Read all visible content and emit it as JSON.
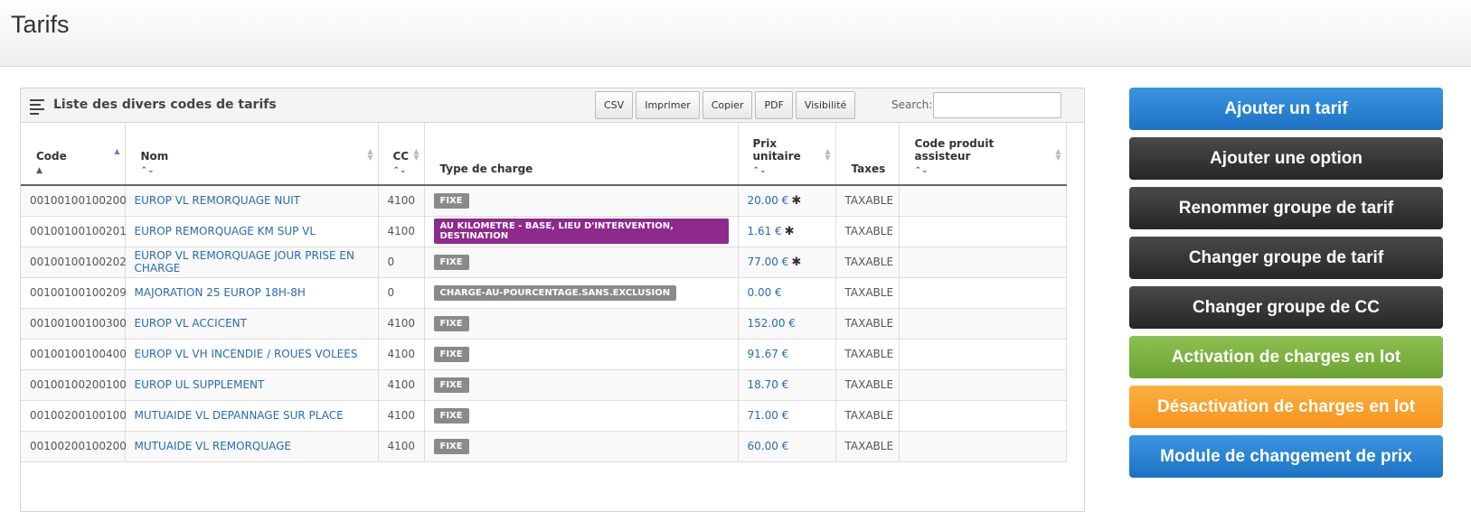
{
  "page": {
    "title": "Tarifs"
  },
  "panel": {
    "title": "Liste des divers codes de tarifs",
    "tools": [
      "CSV",
      "Imprimer",
      "Copier",
      "PDF",
      "Visibilité"
    ],
    "search_label": "Search:",
    "search_value": ""
  },
  "columns": {
    "code": "Code",
    "nom": "Nom",
    "cc": "CC",
    "type": "Type de charge",
    "prix": "Prix unitaire",
    "taxes": "Taxes",
    "assisteur": "Code produit assisteur"
  },
  "rows": [
    {
      "code": "00100100100200",
      "nom": "EUROP VL REMORQUAGE NUIT",
      "cc": "4100",
      "type": "FIXE",
      "type_color": "#8a8a8a",
      "prix": "20.00 €",
      "star": "✱",
      "taxes": "TAXABLE",
      "assisteur": ""
    },
    {
      "code": "00100100100201",
      "nom": "EUROP REMORQUAGE KM SUP VL",
      "cc": "4100",
      "type": "AU KILOMETRE - BASE, LIEU D'INTERVENTION, DESTINATION",
      "type_color": "#8e2a8c",
      "prix": "1.61 €",
      "star": "✱",
      "taxes": "TAXABLE",
      "assisteur": ""
    },
    {
      "code": "00100100100202",
      "nom": "EUROP VL REMORQUAGE JOUR PRISE EN CHARGE",
      "cc": "0",
      "type": "FIXE",
      "type_color": "#8a8a8a",
      "prix": "77.00 €",
      "star": "✱",
      "taxes": "TAXABLE",
      "assisteur": ""
    },
    {
      "code": "00100100100209",
      "nom": "MAJORATION 25 EUROP 18H-8H",
      "cc": "0",
      "type": "CHARGE-AU-POURCENTAGE.SANS.EXCLUSION",
      "type_color": "#8a8a8a",
      "prix": "0.00 €",
      "star": "",
      "taxes": "TAXABLE",
      "assisteur": ""
    },
    {
      "code": "00100100100300",
      "nom": "EUROP VL ACCICENT",
      "cc": "4100",
      "type": "FIXE",
      "type_color": "#8a8a8a",
      "prix": "152.00 €",
      "star": "",
      "taxes": "TAXABLE",
      "assisteur": ""
    },
    {
      "code": "00100100100400",
      "nom": "EUROP VL VH INCENDIE / ROUES VOLEES",
      "cc": "4100",
      "type": "FIXE",
      "type_color": "#8a8a8a",
      "prix": "91.67 €",
      "star": "",
      "taxes": "TAXABLE",
      "assisteur": ""
    },
    {
      "code": "00100100200100",
      "nom": "EUROP UL SUPPLEMENT",
      "cc": "4100",
      "type": "FIXE",
      "type_color": "#8a8a8a",
      "prix": "18.70 €",
      "star": "",
      "taxes": "TAXABLE",
      "assisteur": ""
    },
    {
      "code": "00100200100100",
      "nom": "MUTUAIDE VL DEPANNAGE SUR PLACE",
      "cc": "4100",
      "type": "FIXE",
      "type_color": "#8a8a8a",
      "prix": "71.00 €",
      "star": "",
      "taxes": "TAXABLE",
      "assisteur": ""
    },
    {
      "code": "00100200100200",
      "nom": "MUTUAIDE VL REMORQUAGE",
      "cc": "4100",
      "type": "FIXE",
      "type_color": "#8a8a8a",
      "prix": "60.00 €",
      "star": "",
      "taxes": "TAXABLE",
      "assisteur": ""
    }
  ],
  "sidebar": {
    "buttons": [
      {
        "label": "Ajouter un tarif",
        "style": "blue"
      },
      {
        "label": "Ajouter une option",
        "style": "dark"
      },
      {
        "label": "Renommer groupe de tarif",
        "style": "dark"
      },
      {
        "label": "Changer groupe de tarif",
        "style": "dark"
      },
      {
        "label": "Changer groupe de CC",
        "style": "dark"
      },
      {
        "label": "Activation de charges en lot",
        "style": "green"
      },
      {
        "label": "Désactivation de charges en lot",
        "style": "orange"
      },
      {
        "label": "Module de changement de prix",
        "style": "blue"
      }
    ]
  }
}
